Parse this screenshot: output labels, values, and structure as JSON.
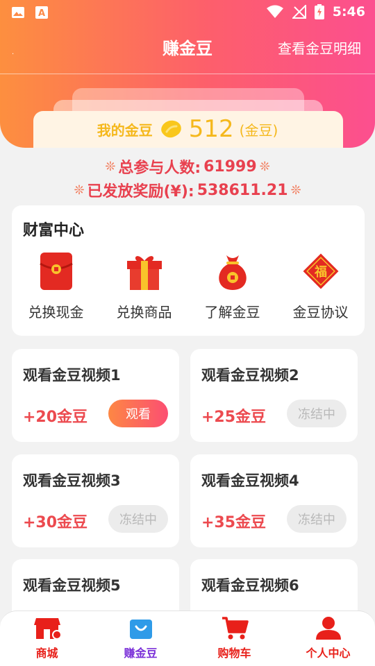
{
  "status_bar": {
    "time": "5:46",
    "icons": [
      "image-icon",
      "font-icon",
      "wifi-icon",
      "no-signal-icon",
      "battery-charging-icon"
    ]
  },
  "header": {
    "dot": ".",
    "title": "赚金豆",
    "detail_link": "查看金豆明细"
  },
  "balance": {
    "label": "我的金豆",
    "value": "512",
    "unit": "(金豆)",
    "icon": "gold-bean-icon"
  },
  "stats": {
    "participants_label": "总参与人数:",
    "participants_value": "61999",
    "rewards_label": "已发放奖励(¥):",
    "rewards_value": "538611.21"
  },
  "wealth_center": {
    "title": "财富中心",
    "items": [
      {
        "label": "兑换现金",
        "icon": "red-envelope-icon"
      },
      {
        "label": "兑换商品",
        "icon": "gift-box-icon"
      },
      {
        "label": "了解金豆",
        "icon": "money-bag-icon"
      },
      {
        "label": "金豆协议",
        "icon": "fu-charm-icon"
      }
    ]
  },
  "tasks": [
    {
      "title": "观看金豆视频1",
      "reward": "+20金豆",
      "button": "观看",
      "state": "active"
    },
    {
      "title": "观看金豆视频2",
      "reward": "+25金豆",
      "button": "冻结中",
      "state": "frozen"
    },
    {
      "title": "观看金豆视频3",
      "reward": "+30金豆",
      "button": "冻结中",
      "state": "frozen"
    },
    {
      "title": "观看金豆视频4",
      "reward": "+35金豆",
      "button": "冻结中",
      "state": "frozen"
    },
    {
      "title": "观看金豆视频5",
      "reward": "",
      "button": "",
      "state": "frozen"
    },
    {
      "title": "观看金豆视频6",
      "reward": "",
      "button": "",
      "state": "frozen"
    }
  ],
  "tab_bar": {
    "items": [
      {
        "label": "商城",
        "icon": "shop-icon",
        "color": "#e8201a"
      },
      {
        "label": "赚金豆",
        "icon": "shopping-bag-icon",
        "color": "#7a2fd8",
        "selected": true
      },
      {
        "label": "购物车",
        "icon": "cart-icon",
        "color": "#e8201a"
      },
      {
        "label": "个人中心",
        "icon": "person-icon",
        "color": "#e8201a"
      }
    ]
  },
  "colors": {
    "header_gradient_start": "#fd8f3f",
    "header_gradient_end": "#fc4f8f",
    "gold": "#f5b81c",
    "reward_red": "#ec4a4f",
    "tab_active": "#7a2fd8",
    "tab_inactive": "#e8201a"
  }
}
